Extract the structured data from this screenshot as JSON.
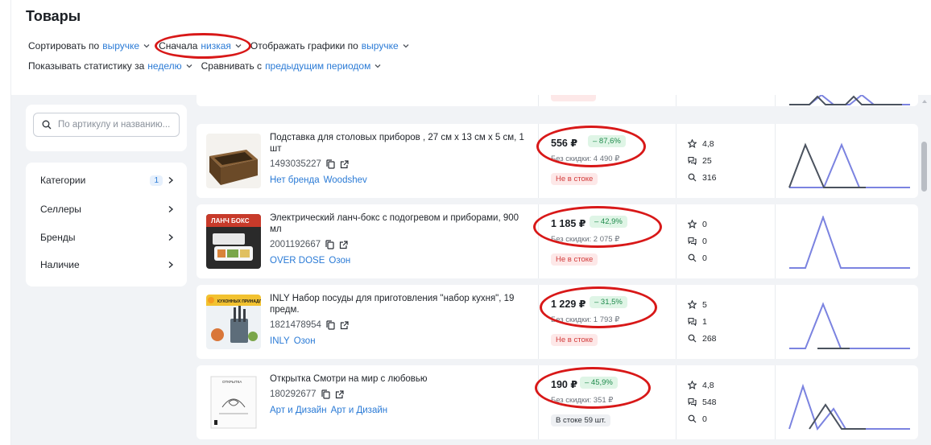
{
  "header": {
    "title": "Товары",
    "sort": {
      "label": "Сортировать по",
      "value": "выручке"
    },
    "order": {
      "label": "Сначала",
      "value": "низкая"
    },
    "charts": {
      "label": "Отображать графики по",
      "value": "выручке"
    },
    "period": {
      "label": "Показывать статистику за",
      "value": "неделю"
    },
    "compare": {
      "label": "Сравнивать с",
      "value": "предыдущим периодом"
    }
  },
  "search": {
    "placeholder": "По артикулу и названию..."
  },
  "sidebar": {
    "items": [
      {
        "label": "Категории",
        "count": "1"
      },
      {
        "label": "Селлеры",
        "count": ""
      },
      {
        "label": "Бренды",
        "count": ""
      },
      {
        "label": "Наличие",
        "count": ""
      }
    ]
  },
  "products": [
    {
      "name": "Подставка для столовых приборов , 27 см х 13 см х 5 см, 1 шт",
      "sku": "1493035227",
      "brands": [
        "Нет бренда",
        "Woodshev"
      ],
      "price": "556 ₽",
      "discount": "– 87,6%",
      "old_price": "Без скидки: 4 490 ₽",
      "stock": "Не в стоке",
      "in_stock": false,
      "rating": "4,8",
      "reviews": "25",
      "queries": "316"
    },
    {
      "name": "Электрический ланч-бокс с подогревом и приборами, 900 мл",
      "sku": "2001192667",
      "brands": [
        "OVER DOSE",
        "Озон"
      ],
      "price": "1 185 ₽",
      "discount": "– 42,9%",
      "old_price": "Без скидки: 2 075 ₽",
      "stock": "Не в стоке",
      "in_stock": false,
      "rating": "0",
      "reviews": "0",
      "queries": "0"
    },
    {
      "name": "INLY Набор посуды для приготовления \"набор кухня\", 19 предм.",
      "sku": "1821478954",
      "brands": [
        "INLY",
        "Озон"
      ],
      "price": "1 229 ₽",
      "discount": "– 31,5%",
      "old_price": "Без скидки: 1 793 ₽",
      "stock": "Не в стоке",
      "in_stock": false,
      "rating": "5",
      "reviews": "1",
      "queries": "268"
    },
    {
      "name": "Открытка Смотри на мир с любовью",
      "sku": "180292677",
      "brands": [
        "Арт и Дизайн",
        "Арт и Дизайн"
      ],
      "price": "190 ₽",
      "discount": "– 45,9%",
      "old_price": "Без скидки: 351 ₽",
      "stock": "В стоке 59 шт.",
      "in_stock": true,
      "rating": "4,8",
      "reviews": "548",
      "queries": "0"
    }
  ],
  "thumb_text": {
    "lunchbox": "ЛАНЧ БОКС",
    "cookware": "КУХОННЫХ ПРИНАДЛЕЖНОСТЕЙ",
    "postcard": "ОТКРЫТКА"
  },
  "colors": {
    "accent": "#2b7bd6",
    "highlight_circle": "#d81818",
    "chart_current": "#7b83e0",
    "chart_previous": "#4a525e",
    "discount_bg": "#dff5e6",
    "out_of_stock": "#d23a3a"
  }
}
